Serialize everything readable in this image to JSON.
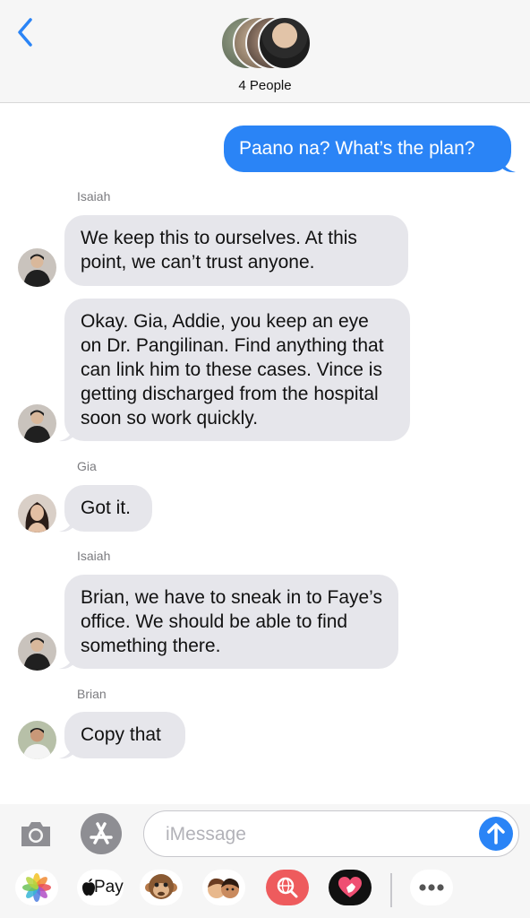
{
  "header": {
    "title": "4 People",
    "back_icon": "chevron-left-icon",
    "accent": "#2a84f6"
  },
  "messages": [
    {
      "direction": "outgoing",
      "text": "Paano na? What’s the plan?"
    },
    {
      "direction": "incoming",
      "sender": "Isaiah",
      "text": "We keep this to ourselves. At this point, we can’t trust anyone."
    },
    {
      "direction": "incoming",
      "sender": "",
      "text": "Okay. Gia, Addie, you keep an eye on Dr. Pangilinan. Find anything that can link him to these cases. Vince is getting discharged from the hospital soon so work quickly."
    },
    {
      "direction": "incoming",
      "sender": "Gia",
      "text": "Got it."
    },
    {
      "direction": "incoming",
      "sender": "Isaiah",
      "text": "Brian, we have to sneak in to Faye’s office. We should be able to find something there."
    },
    {
      "direction": "incoming",
      "sender": "Brian",
      "text": "Copy that"
    }
  ],
  "composer": {
    "placeholder": "iMessage",
    "value": "",
    "camera_icon": "camera-icon",
    "appstore_icon": "app-store-icon",
    "send_icon": "arrow-up-icon"
  },
  "app_drawer": {
    "apps": [
      {
        "name": "photos-icon"
      },
      {
        "name": "apple-pay-icon",
        "label": "Pay"
      },
      {
        "name": "animoji-icon"
      },
      {
        "name": "memoji-icon"
      },
      {
        "name": "web-images-icon"
      },
      {
        "name": "digital-touch-icon"
      },
      {
        "name": "more-icon"
      }
    ]
  },
  "colors": {
    "incoming_bubble": "#e6e6eb",
    "outgoing_bubble": "#2a84f6",
    "header_bg": "#f6f6f6"
  }
}
